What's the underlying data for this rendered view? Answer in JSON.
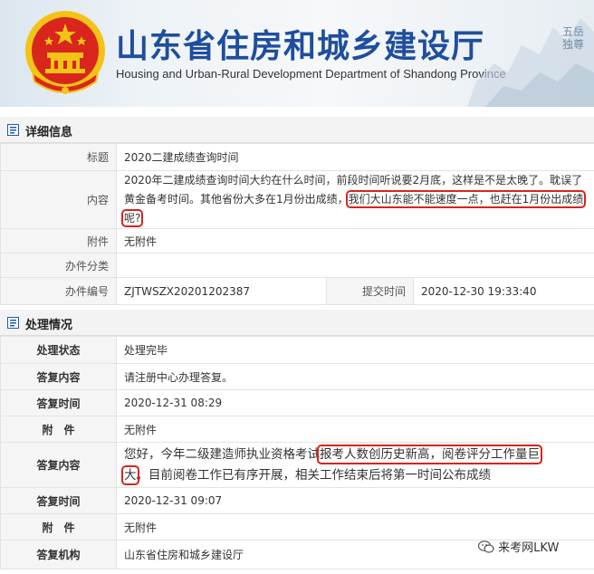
{
  "header": {
    "title": "山东省住房和城乡建设厅",
    "subtitle": "Housing and Urban-Rural Development Department of Shandong Province",
    "seal_text": "五岳独尊"
  },
  "detail": {
    "section_title": "详细信息",
    "title_label": "标题",
    "title_value": "2020二建成绩查询时间",
    "content_label": "内容",
    "content_part1": "2020年二建成绩查询时间大约在什么时间，前段时间听说要2月底，这样是不是太晚了。耽误了黄金备考时间。其他省份大多在1月份出成绩，",
    "content_highlight": "我们大山东能不能速度一点，也赶在1月份出成绩呢?",
    "attachment_label": "附件",
    "attachment_value": "无附件",
    "category_label": "办件分类",
    "category_value": "",
    "number_label": "办件编号",
    "number_value": "ZJTWSZX20201202387",
    "submit_label": "提交时间",
    "submit_value": "2020-12-30 19:33:40"
  },
  "process": {
    "section_title": "处理情况",
    "status_label": "处理状态",
    "status_value": "处理完毕",
    "reply1_label": "答复内容",
    "reply1_value": "请注册中心办理答复。",
    "time1_label": "答复时间",
    "time1_value": "2020-12-31 08:29",
    "attach1_label": "附　件",
    "attach1_value": "无附件",
    "reply2_label": "答复内容",
    "reply2_part1": "您好，今年二级建造师执业资格考试",
    "reply2_highlight1": "报考人数创历史新高，阅卷评分工作量巨",
    "reply2_highlight2": "大",
    "reply2_part2": "。目前阅卷工作已有序开展，相关工作结束后将第一时间公布成绩",
    "time2_label": "答复时间",
    "time2_value": "2020-12-31 09:07",
    "attach2_label": "附　件",
    "attach2_value": "无附件",
    "org_label": "答复机构",
    "org_value": "山东省住房和城乡建设厅"
  },
  "watermark": {
    "text": "来考网LKW",
    "icon": "wechat-icon"
  },
  "colors": {
    "title_blue": "#1f4e9d",
    "highlight_red": "#d9241c",
    "emblem_red": "#d8261d",
    "emblem_gold": "#f3c316"
  }
}
